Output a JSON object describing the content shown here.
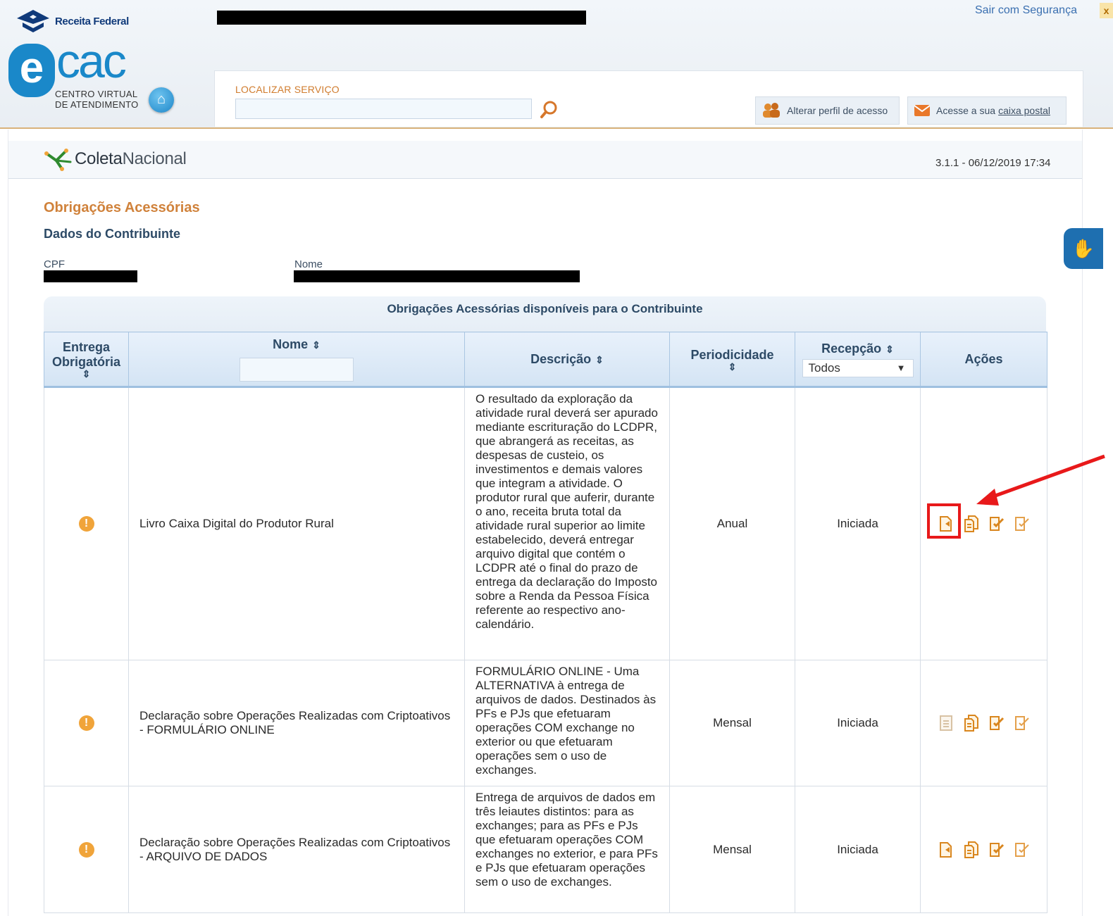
{
  "header": {
    "brand": "Receita Federal",
    "exit_label": "Sair com Segurança",
    "close_glyph": "x",
    "ecac_letter": "e",
    "ecac_word": "cac",
    "ecac_subtitle_line1": "CENTRO VIRTUAL",
    "ecac_subtitle_line2": "DE ATENDIMENTO",
    "search_label": "LOCALIZAR SERVIÇO",
    "search_value": "",
    "profile_button": "Alterar perfil de acesso",
    "mailbox_prefix": "Acesse a sua",
    "mailbox_link": "caixa postal"
  },
  "app": {
    "name_bold": "Coleta",
    "name_light": "Nacional",
    "version": "3.1.1 - 06/12/2019 17:34"
  },
  "page": {
    "title": "Obrigações Acessórias",
    "section": "Dados do Contribuinte",
    "cpf_label": "CPF",
    "name_label": "Nome"
  },
  "table": {
    "caption": "Obrigações Acessórias disponíveis para o Contribuinte",
    "columns": {
      "mandatory": "Entrega Obrigatória",
      "name": "Nome",
      "description": "Descrição",
      "periodicity": "Periodicidade",
      "reception": "Recepção",
      "actions": "Ações"
    },
    "reception_filter": "Todos",
    "sort_glyph": "⇕",
    "rows": [
      {
        "name": "Livro Caixa Digital do Produtor Rural",
        "description": "O resultado da exploração da atividade rural deverá ser apurado mediante escrituração do LCDPR, que abrangerá as receitas, as despesas de custeio, os investimentos e demais valores que integram a atividade. O produtor rural que auferir, durante o ano, receita bruta total da atividade rural superior ao limite estabelecido, deverá entregar arquivo digital que contém o LCDPR até o final do prazo de entrega da declaração do Imposto sobre a Renda da Pessoa Física referente ao respectivo ano-calendário.",
        "periodicity": "Anual",
        "reception": "Iniciada"
      },
      {
        "name": "Declaração sobre Operações Realizadas com Criptoativos - FORMULÁRIO ONLINE",
        "description": "FORMULÁRIO ONLINE - Uma ALTERNATIVA à entrega de arquivos de dados. Destinados às PFs e PJs que efetuaram operações COM exchange no exterior ou que efetuaram operações sem o uso de exchanges.",
        "periodicity": "Mensal",
        "reception": "Iniciada"
      },
      {
        "name": "Declaração sobre Operações Realizadas com Criptoativos - ARQUIVO DE DADOS",
        "description": "Entrega de arquivos de dados em três leiautes distintos: para as exchanges; para as PFs e PJs que efetuaram operações COM exchanges no exterior, e para PFs e PJs que efetuaram operações sem o uso de exchanges.",
        "periodicity": "Mensal",
        "reception": "Iniciada"
      }
    ]
  },
  "colors": {
    "accent_orange": "#d0823b",
    "header_blue": "#2d4a66",
    "brand_blue": "#1a88c9",
    "highlight_red": "#e8191a"
  }
}
